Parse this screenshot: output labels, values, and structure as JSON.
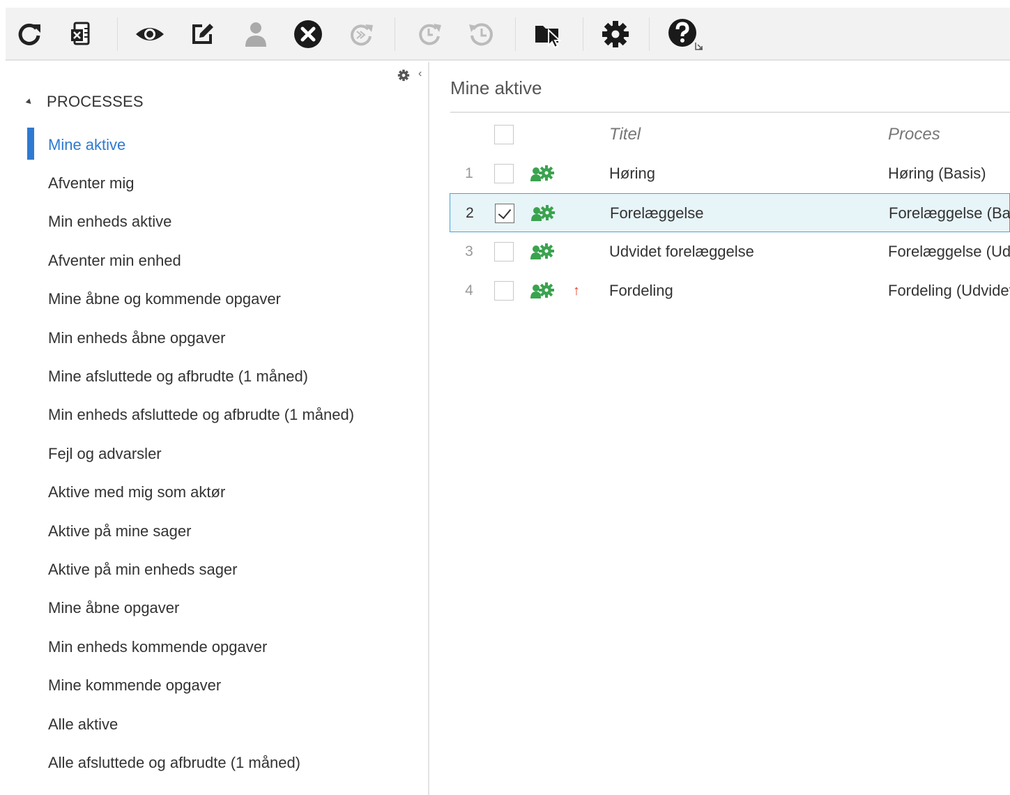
{
  "toolbar": {
    "buttons": [
      {
        "name": "refresh",
        "icon": "refresh-icon",
        "enabled": true
      },
      {
        "name": "export-excel",
        "icon": "excel-export-icon",
        "enabled": true
      },
      {
        "name": "view",
        "icon": "eye-icon",
        "enabled": true
      },
      {
        "name": "edit",
        "icon": "edit-icon",
        "enabled": true
      },
      {
        "name": "user",
        "icon": "user-icon",
        "enabled": false
      },
      {
        "name": "cancel",
        "icon": "close-circle-icon",
        "enabled": true
      },
      {
        "name": "forward",
        "icon": "forward-icon",
        "enabled": false
      },
      {
        "name": "redo",
        "icon": "redo-clock-icon",
        "enabled": false
      },
      {
        "name": "history",
        "icon": "history-icon",
        "enabled": false
      },
      {
        "name": "select-folder",
        "icon": "folder-cursor-icon",
        "enabled": true
      },
      {
        "name": "settings",
        "icon": "gear-icon",
        "enabled": true
      },
      {
        "name": "help",
        "icon": "help-icon",
        "enabled": true
      }
    ]
  },
  "sidebar": {
    "section_title": "PROCESSES",
    "items": [
      {
        "label": "Mine aktive",
        "active": true
      },
      {
        "label": "Afventer mig",
        "active": false
      },
      {
        "label": "Min enheds aktive",
        "active": false
      },
      {
        "label": "Afventer min enhed",
        "active": false
      },
      {
        "label": "Mine åbne og kommende opgaver",
        "active": false
      },
      {
        "label": "Min enheds åbne opgaver",
        "active": false
      },
      {
        "label": "Mine afsluttede og afbrudte (1 måned)",
        "active": false
      },
      {
        "label": "Min enheds afsluttede og afbrudte (1 måned)",
        "active": false
      },
      {
        "label": "Fejl og advarsler",
        "active": false
      },
      {
        "label": "Aktive med mig som aktør",
        "active": false
      },
      {
        "label": "Aktive på mine sager",
        "active": false
      },
      {
        "label": "Aktive på min enheds sager",
        "active": false
      },
      {
        "label": "Mine åbne opgaver",
        "active": false
      },
      {
        "label": "Min enheds kommende opgaver",
        "active": false
      },
      {
        "label": "Mine kommende opgaver",
        "active": false
      },
      {
        "label": "Alle aktive",
        "active": false
      },
      {
        "label": "Alle afsluttede og afbrudte (1 måned)",
        "active": false
      }
    ]
  },
  "main": {
    "title": "Mine aktive",
    "columns": {
      "titel": "Titel",
      "proces": "Proces"
    },
    "rows": [
      {
        "num": "1",
        "checked": false,
        "selected": false,
        "priority": "",
        "titel": "Høring",
        "proces": "Høring (Basis)"
      },
      {
        "num": "2",
        "checked": true,
        "selected": true,
        "priority": "",
        "titel": "Forelæggelse",
        "proces": "Forelæggelse (Basis)"
      },
      {
        "num": "3",
        "checked": false,
        "selected": false,
        "priority": "",
        "titel": "Udvidet forelæggelse",
        "proces": "Forelæggelse (Udvidet)"
      },
      {
        "num": "4",
        "checked": false,
        "selected": false,
        "priority": "↑",
        "titel": "Fordeling",
        "proces": "Fordeling (Udvidet)"
      }
    ]
  },
  "colors": {
    "accent": "#2e7ad1",
    "process_icon": "#3aa34f",
    "priority": "#e04028",
    "selected_row": "#e7f4f8"
  }
}
